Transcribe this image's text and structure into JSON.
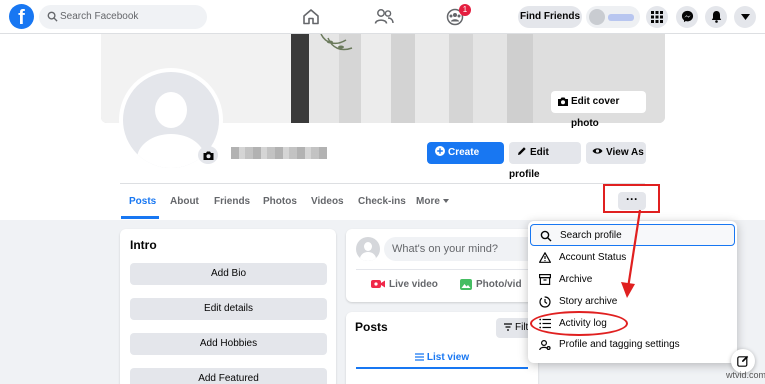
{
  "nav": {
    "logo": "f",
    "search_placeholder": "Search Facebook",
    "notification_badge": "1",
    "find_friends_label": "Find Friends"
  },
  "profile": {
    "edit_cover_label": "Edit cover photo",
    "create_story_label": "Create story",
    "edit_profile_label": "Edit profile",
    "view_as_label": "View As"
  },
  "tabs": [
    {
      "label": "Posts",
      "active": true
    },
    {
      "label": "About"
    },
    {
      "label": "Friends"
    },
    {
      "label": "Photos"
    },
    {
      "label": "Videos"
    },
    {
      "label": "Check-ins"
    },
    {
      "label": "More"
    }
  ],
  "more_button_label": "···",
  "intro": {
    "title": "Intro",
    "buttons": [
      "Add Bio",
      "Edit details",
      "Add Hobbies",
      "Add Featured"
    ]
  },
  "composer": {
    "placeholder": "What's on your mind?",
    "live_video": "Live video",
    "photo_video": "Photo/vid"
  },
  "posts": {
    "title": "Posts",
    "filter_label": "Filt",
    "list_view_label": "List view"
  },
  "dropdown": {
    "items": [
      {
        "label": "Search profile",
        "icon": "search-icon"
      },
      {
        "label": "Account Status",
        "icon": "warning-icon"
      },
      {
        "label": "Archive",
        "icon": "archive-icon"
      },
      {
        "label": "Story archive",
        "icon": "clock-icon"
      },
      {
        "label": "Activity log",
        "icon": "list-icon"
      },
      {
        "label": "Profile and tagging settings",
        "icon": "gear-icon"
      }
    ]
  },
  "watermark": "wtvid.com",
  "colors": {
    "brand": "#1877f2",
    "annotation_red": "#e02020",
    "badge_red": "#e41e3f"
  }
}
